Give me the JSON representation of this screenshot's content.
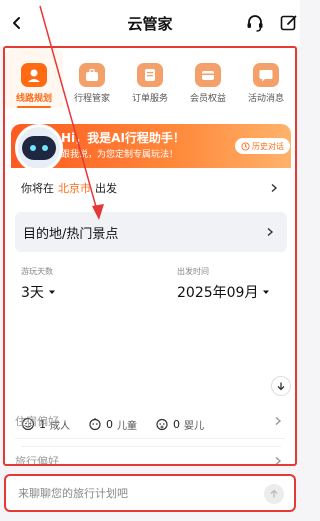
{
  "header": {
    "title": "云管家",
    "back_icon": "chevron-left-icon",
    "right_icons": [
      "headset-icon",
      "edit-icon"
    ]
  },
  "tabs": [
    {
      "label": "线路规划",
      "icon": "person-pin-icon",
      "active": true
    },
    {
      "label": "行程管家",
      "icon": "suitcase-icon",
      "active": false
    },
    {
      "label": "订单服务",
      "icon": "document-icon",
      "active": false
    },
    {
      "label": "会员权益",
      "icon": "card-icon",
      "active": false
    },
    {
      "label": "活动消息",
      "icon": "chat-icon",
      "active": false
    }
  ],
  "banner": {
    "title": "Hi，我是AI行程助手！",
    "subtitle": "跟我说，为您定制专属玩法！",
    "history_label": "历史对话"
  },
  "planner": {
    "depart_prefix": "你将在",
    "depart_city": "北京市",
    "depart_suffix": "出发",
    "destination_placeholder": "目的地/热门景点",
    "days_label": "游玩天数",
    "days_value": "3天",
    "date_label": "出发时间",
    "date_value": "2025年09月",
    "adults_count": "1",
    "adults_unit": "成人",
    "children_count": "0",
    "children_unit": "儿童",
    "infants_count": "0",
    "infants_unit": "婴儿",
    "stay_pref_label": "住宿偏好",
    "travel_pref_label": "旅行偏好"
  },
  "chat": {
    "placeholder": "来聊聊您的旅行计划吧"
  },
  "colors": {
    "accent": "#ff6a13",
    "annotation_red": "#e53935"
  }
}
